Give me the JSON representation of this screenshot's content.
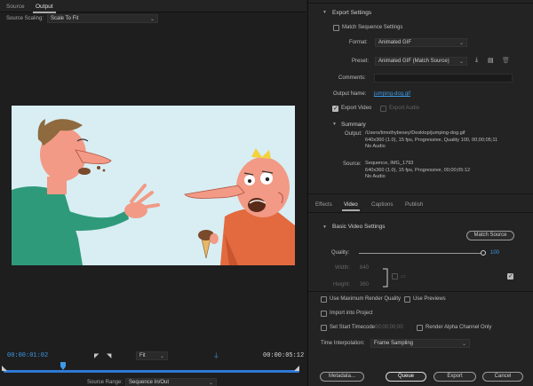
{
  "source_tabs": [
    "Source",
    "Output"
  ],
  "source_scaling": {
    "label": "Source Scaling:",
    "value": "Scale To Fit"
  },
  "transport": {
    "current_tc": "00:00:01:02",
    "fit": "Fit",
    "end_tc": "00:00:05:12",
    "source_range_label": "Source Range:",
    "source_range_value": "Sequence In/Out"
  },
  "export_settings": {
    "header": "Export Settings",
    "match_sequence": "Match Sequence Settings",
    "format_label": "Format:",
    "format_value": "Animated GIF",
    "preset_label": "Preset:",
    "preset_value": "Animated GIF (Match Source)",
    "comments_label": "Comments:",
    "output_name_label": "Output Name:",
    "output_name_value": "jumping-dog.gif",
    "export_video": "Export Video",
    "export_audio": "Export Audio",
    "summary_header": "Summary",
    "output_label": "Output:",
    "output_lines": [
      "/Users/timothybesey/Desktop/jumping-dog.gif",
      "640x360 (1.0), 15 fps, Progressive, Quality 100, 00;00;05;11",
      "No Audio"
    ],
    "source_label": "Source:",
    "source_lines": [
      "Sequence, IMG_1793",
      "640x360 (1.0), 15 fps, Progressive, 00;00;05:12",
      "No Audio"
    ]
  },
  "right_tabs": [
    "Effects",
    "Video",
    "Captions",
    "Publish"
  ],
  "basic_video": {
    "header": "Basic Video Settings",
    "match_source": "Match Source",
    "quality_label": "Quality:",
    "quality_value": "100",
    "quality_fraction": 1.0,
    "width_label": "Width:",
    "width_value": "640",
    "height_label": "Height:",
    "height_value": "360"
  },
  "options": {
    "max_render": "Use Maximum Render Quality",
    "use_previews": "Use Previews",
    "import_project": "Import into Project",
    "set_start_tc": "Set Start Timecode",
    "start_tc_value": "00;00;00;00",
    "render_alpha": "Render Alpha Channel Only",
    "time_interp_label": "Time Interpolation:",
    "time_interp_value": "Frame Sampling"
  },
  "buttons": {
    "metadata": "Metadata...",
    "queue": "Queue",
    "export": "Export",
    "cancel": "Cancel"
  },
  "colors": {
    "accent_blue": "#3e9ae8",
    "panel_bg": "#232323",
    "sky": "#d7ecf2"
  }
}
